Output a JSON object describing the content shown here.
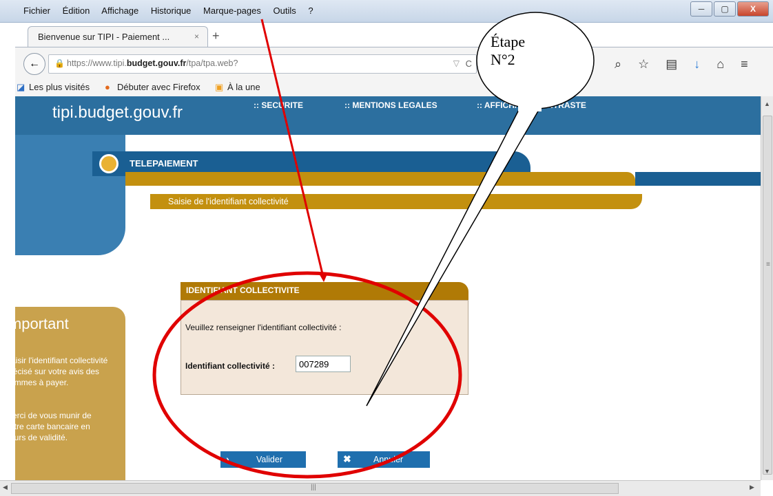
{
  "menu": [
    "Fichier",
    "Édition",
    "Affichage",
    "Historique",
    "Marque-pages",
    "Outils",
    "?"
  ],
  "window_controls": {
    "minimize": "─",
    "maximize": "▢",
    "close": "X"
  },
  "tab": {
    "label": "Bienvenue sur TIPI - Paiement ...",
    "close": "×",
    "new": "+"
  },
  "nav": {
    "back": "←",
    "url_prefix": "https://www.tipi.",
    "url_bold": "budget.gouv.fr",
    "url_suffix": "/tpa/tpa.web?",
    "dropdown": "▽",
    "reload": "C",
    "icons": [
      "⌕",
      "☆",
      "▤",
      "↓",
      "⌂",
      "≡"
    ]
  },
  "bookmarks": [
    "Les plus visités",
    "Débuter avec Firefox",
    "À la une"
  ],
  "site": {
    "name": "tipi.budget.gouv.fr",
    "links": [
      "SECURITE",
      "MENTIONS LEGALES",
      "AFFICHAGE CONTRASTE"
    ],
    "section": "TELEPAIEMENT",
    "step": "Saisie de l'identifiant collectivité"
  },
  "panel": {
    "title": "IDENTIFIANT COLLECTIVITE",
    "prompt": "Veuillez renseigner l'identifiant collectivité :",
    "field_label": "Identifiant collectivité :",
    "field_value": "007289"
  },
  "important": {
    "title": "important",
    "p1": "Saisir l'identifiant collectivité précisé sur votre avis des sommes à payer.",
    "p2": "Merci de vous munir de votre carte bancaire en cours de validité."
  },
  "buttons": {
    "validate": "Valider",
    "cancel": "Annuler",
    "validate_icon": "›",
    "cancel_icon": "✖"
  },
  "scrollbars": {
    "up": "▲",
    "down": "▼",
    "left": "◀",
    "right": "▶",
    "grip_v": "≡",
    "grip_h": "|||"
  },
  "annotation": {
    "line1": "Étape",
    "line2": "N°2",
    "color": "#e00000"
  }
}
